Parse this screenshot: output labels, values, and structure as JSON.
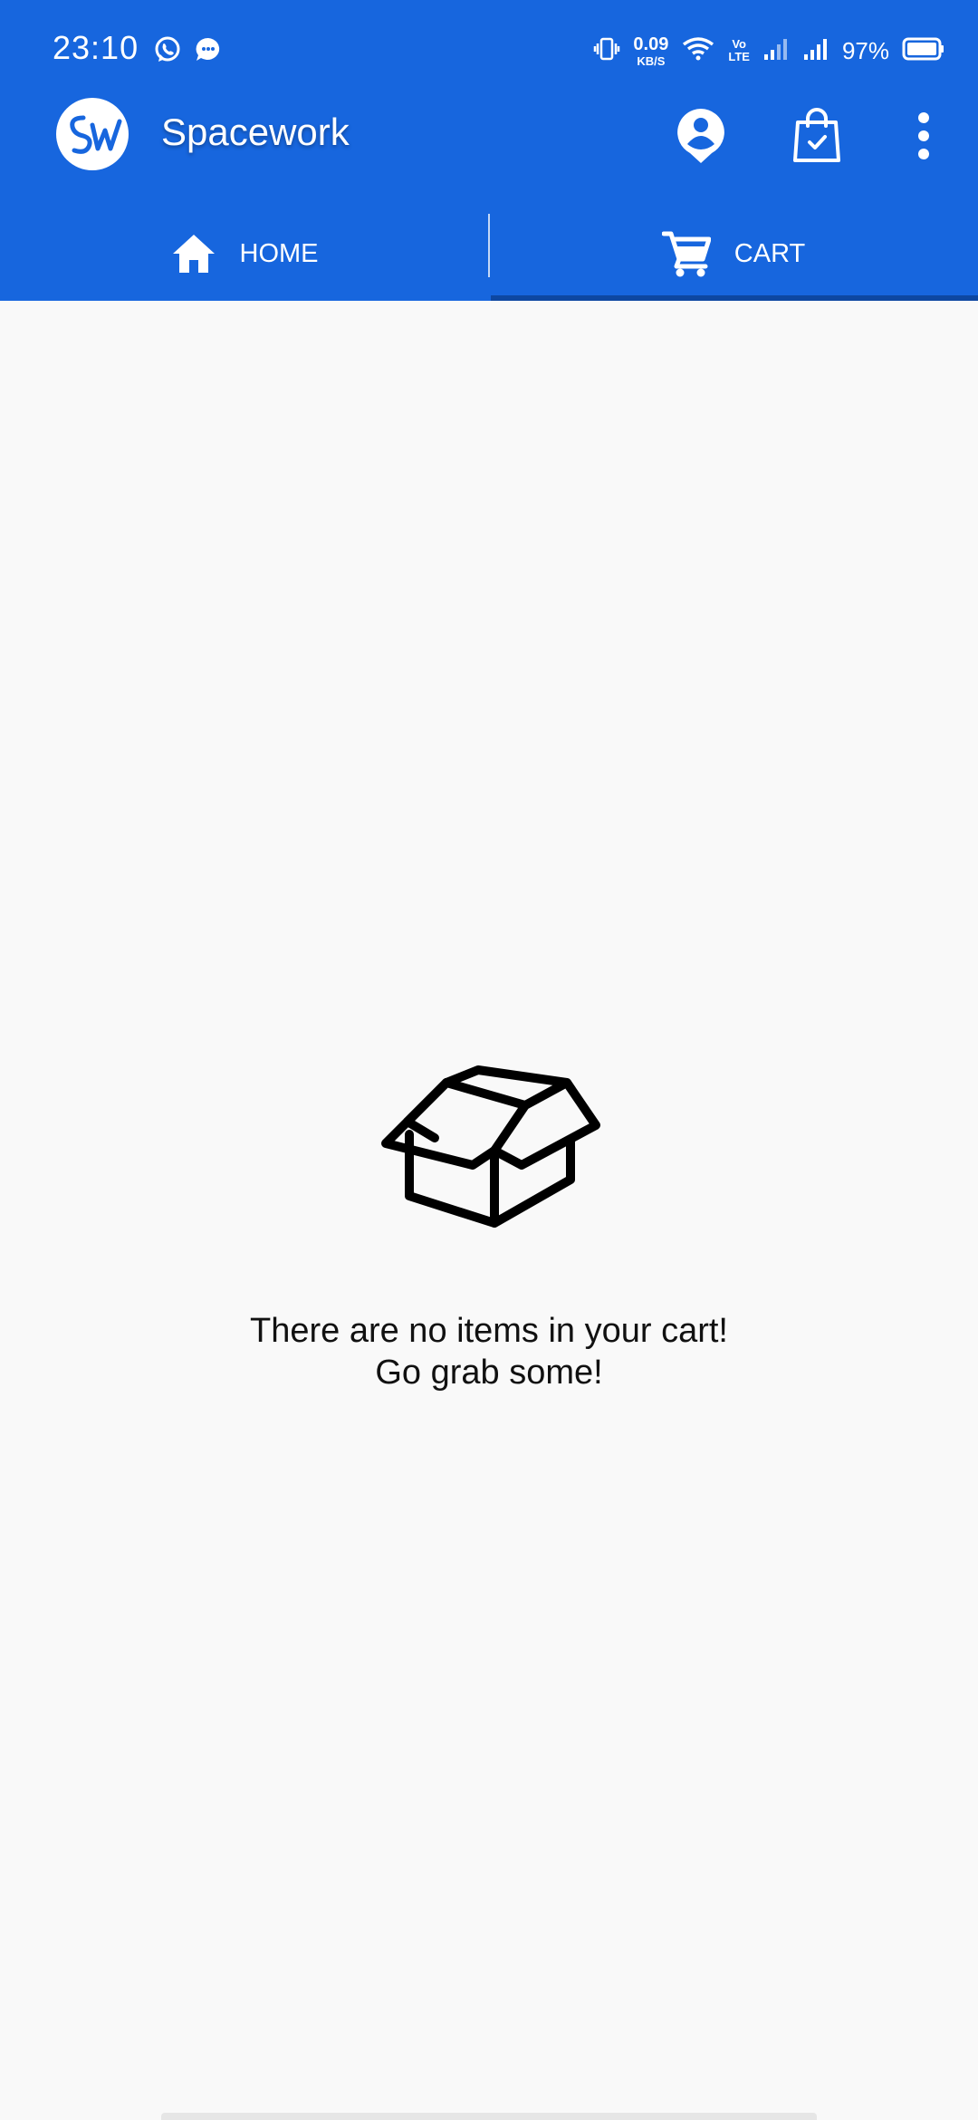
{
  "status_bar": {
    "time": "23:10",
    "net_speed_value": "0.09",
    "net_speed_unit": "KB/S",
    "volte_top": "Vo",
    "volte_bottom": "LTE",
    "battery": "97%",
    "left_icons": [
      "whatsapp-icon",
      "message-icon"
    ],
    "right_icons": [
      "vibrate-icon",
      "wifi-icon",
      "signal-icon",
      "signal-icon",
      "battery-icon"
    ]
  },
  "app_bar": {
    "title": "Spacework",
    "logo_text": "SW",
    "actions": [
      "account-icon",
      "shopping-bag-icon",
      "more-vert-icon"
    ]
  },
  "tabs": [
    {
      "label": "HOME",
      "icon": "home-icon",
      "selected": false
    },
    {
      "label": "CART",
      "icon": "cart-icon",
      "selected": true
    }
  ],
  "empty_state": {
    "icon": "open-box-icon",
    "line1": "There are no items in your cart!",
    "line2": "Go grab some!"
  },
  "colors": {
    "primary": "#1766de",
    "indicator": "#0d47a1",
    "background": "#f9f9f9",
    "text": "#111111"
  }
}
